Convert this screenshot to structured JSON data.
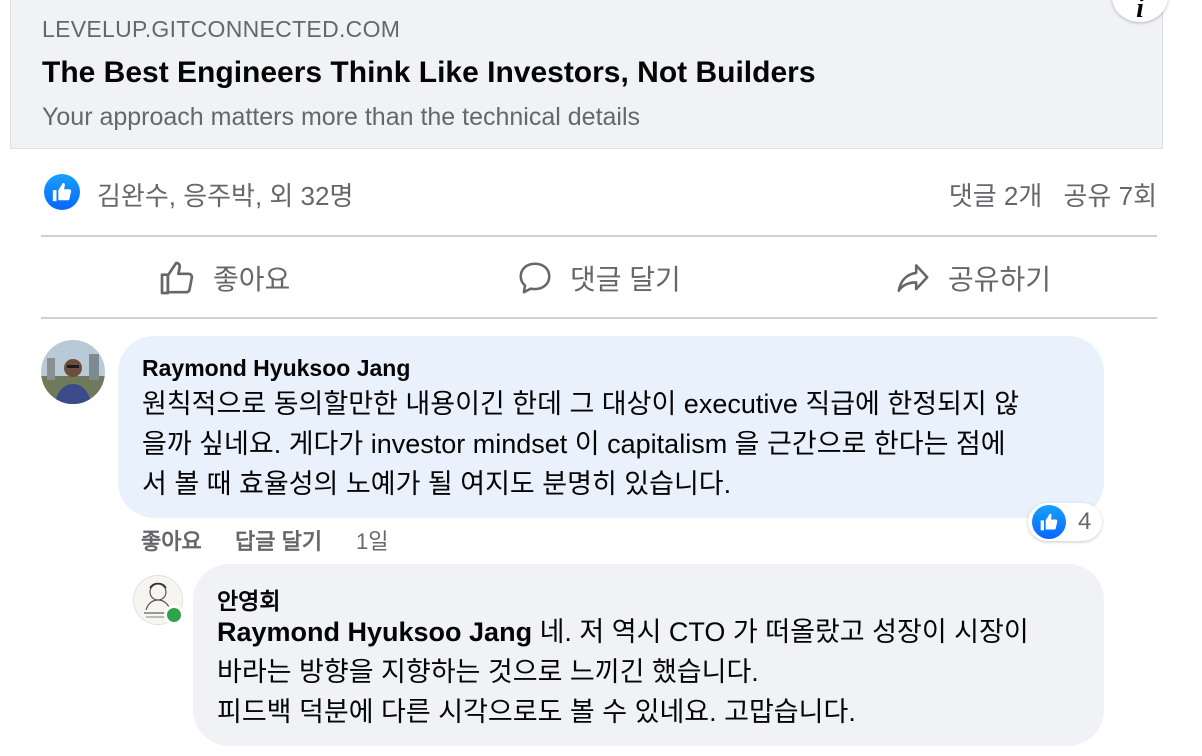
{
  "link_preview": {
    "domain": "LEVELUP.GITCONNECTED.COM",
    "title": "The Best Engineers Think Like Investors, Not Builders",
    "subtitle": "Your approach matters more than the technical details",
    "info_icon": "i"
  },
  "reactions": {
    "icon": "like-icon",
    "names": "김완수, 응주박, 외 32명",
    "comments_count": "댓글 2개",
    "shares_count": "공유 7회"
  },
  "actions": {
    "like": "좋아요",
    "comment": "댓글 달기",
    "share": "공유하기"
  },
  "comments": [
    {
      "author": "Raymond Hyuksoo Jang",
      "lines": [
        "원칙적으로 동의할만한 내용이긴 한데 그 대상이 executive 직급에 한정되지 않",
        "을까 싶네요. 게다가 investor mindset 이 capitalism 을 근간으로 한다는 점에",
        "서 볼 때 효율성의 노예가 될 여지도 분명히 있습니다."
      ],
      "like_label": "좋아요",
      "reply_label": "답글 달기",
      "time": "1일",
      "reaction_count": "4"
    },
    {
      "author": "안영회",
      "mention": "Raymond Hyuksoo Jang",
      "lines": [
        " 네. 저 역시 CTO 가 떠올랐고 성장이 시장이",
        "바라는 방향을 지향하는 것으로 느끼긴 했습니다.",
        "피드백 덕분에 다른 시각으로도 볼 수 있네요. 고맙습니다."
      ]
    }
  ],
  "colors": {
    "brand_blue": "#0866ff",
    "secondary_text": "#65676b",
    "bubble_bg": "#f0f2f5",
    "highlight_bubble_bg": "#e8f1fc",
    "online": "#31a24c"
  }
}
